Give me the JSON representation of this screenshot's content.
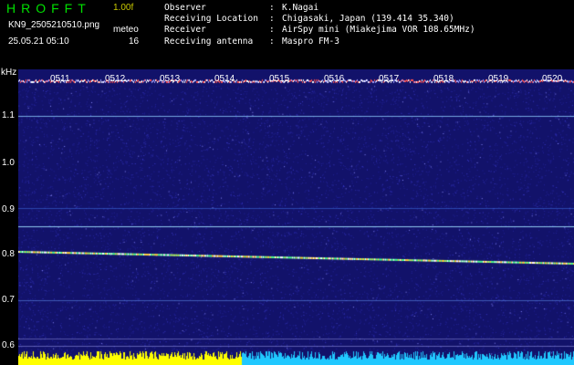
{
  "header": {
    "app_title": "HROFFT",
    "version": "1.00f",
    "filename": "KN9_2505210510.png",
    "datetime": "25.05.21 05:10",
    "meteor_label": "meteo",
    "meteor_count": "16",
    "info": [
      {
        "label": "Observer",
        "value": "K.Nagai"
      },
      {
        "label": "Receiving Location",
        "value": "Chigasaki, Japan (139.414 35.340)"
      },
      {
        "label": "Receiver",
        "value": "AirSpy mini (Miakejima VOR 108.65MHz)"
      },
      {
        "label": "Receiving antenna",
        "value": "Maspro FM-3"
      }
    ]
  },
  "spectrogram": {
    "y_unit": "kHz",
    "y_ticks": [
      "1.1",
      "1.0",
      "0.9",
      "0.8",
      "0.7",
      "0.6"
    ],
    "time_ticks": [
      "0511",
      "0512",
      "0513",
      "0514",
      "0515",
      "0516",
      "0517",
      "0518",
      "0519",
      "0520"
    ],
    "colors": {
      "background": "#12126a",
      "noise": "#3a3ac8",
      "header_text": "#00e000",
      "version_text": "#c8c800",
      "bottom_strip": "#ffff00",
      "bottom_strip_alt": "#20c8ff"
    }
  }
}
